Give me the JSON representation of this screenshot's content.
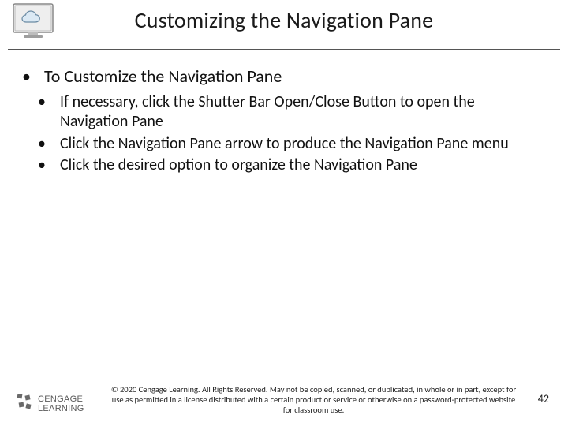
{
  "header": {
    "title": "Customizing the Navigation Pane",
    "icon_name": "cloud-in-frame-icon"
  },
  "body": {
    "l1": "To Customize the Navigation Pane",
    "l2_items": [
      "If necessary, click the Shutter Bar Open/Close Button to open the Navigation Pane",
      "Click the Navigation Pane arrow to produce the Navigation Pane menu",
      "Click the desired option to organize the Navigation Pane"
    ]
  },
  "footer": {
    "logo_line1": "CENGAGE",
    "logo_line2": "Learning",
    "copyright": "© 2020 Cengage Learning. All Rights Reserved. May not be copied, scanned, or duplicated, in whole or in part, except for use as permitted in a license distributed with a certain product or service or otherwise on a password-protected website for classroom use.",
    "page_number": "42"
  },
  "colors": {
    "text": "#111111",
    "rule": "#555555",
    "logo_gray": "#5a5a5a"
  }
}
